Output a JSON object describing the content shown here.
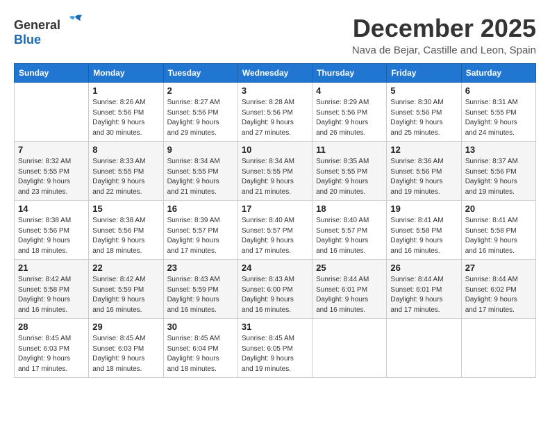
{
  "header": {
    "logo_general": "General",
    "logo_blue": "Blue",
    "month_title": "December 2025",
    "location": "Nava de Bejar, Castille and Leon, Spain"
  },
  "days_of_week": [
    "Sunday",
    "Monday",
    "Tuesday",
    "Wednesday",
    "Thursday",
    "Friday",
    "Saturday"
  ],
  "weeks": [
    [
      {
        "day": "",
        "info": ""
      },
      {
        "day": "1",
        "info": "Sunrise: 8:26 AM\nSunset: 5:56 PM\nDaylight: 9 hours\nand 30 minutes."
      },
      {
        "day": "2",
        "info": "Sunrise: 8:27 AM\nSunset: 5:56 PM\nDaylight: 9 hours\nand 29 minutes."
      },
      {
        "day": "3",
        "info": "Sunrise: 8:28 AM\nSunset: 5:56 PM\nDaylight: 9 hours\nand 27 minutes."
      },
      {
        "day": "4",
        "info": "Sunrise: 8:29 AM\nSunset: 5:56 PM\nDaylight: 9 hours\nand 26 minutes."
      },
      {
        "day": "5",
        "info": "Sunrise: 8:30 AM\nSunset: 5:56 PM\nDaylight: 9 hours\nand 25 minutes."
      },
      {
        "day": "6",
        "info": "Sunrise: 8:31 AM\nSunset: 5:55 PM\nDaylight: 9 hours\nand 24 minutes."
      }
    ],
    [
      {
        "day": "7",
        "info": "Sunrise: 8:32 AM\nSunset: 5:55 PM\nDaylight: 9 hours\nand 23 minutes."
      },
      {
        "day": "8",
        "info": "Sunrise: 8:33 AM\nSunset: 5:55 PM\nDaylight: 9 hours\nand 22 minutes."
      },
      {
        "day": "9",
        "info": "Sunrise: 8:34 AM\nSunset: 5:55 PM\nDaylight: 9 hours\nand 21 minutes."
      },
      {
        "day": "10",
        "info": "Sunrise: 8:34 AM\nSunset: 5:55 PM\nDaylight: 9 hours\nand 21 minutes."
      },
      {
        "day": "11",
        "info": "Sunrise: 8:35 AM\nSunset: 5:55 PM\nDaylight: 9 hours\nand 20 minutes."
      },
      {
        "day": "12",
        "info": "Sunrise: 8:36 AM\nSunset: 5:56 PM\nDaylight: 9 hours\nand 19 minutes."
      },
      {
        "day": "13",
        "info": "Sunrise: 8:37 AM\nSunset: 5:56 PM\nDaylight: 9 hours\nand 19 minutes."
      }
    ],
    [
      {
        "day": "14",
        "info": "Sunrise: 8:38 AM\nSunset: 5:56 PM\nDaylight: 9 hours\nand 18 minutes."
      },
      {
        "day": "15",
        "info": "Sunrise: 8:38 AM\nSunset: 5:56 PM\nDaylight: 9 hours\nand 18 minutes."
      },
      {
        "day": "16",
        "info": "Sunrise: 8:39 AM\nSunset: 5:57 PM\nDaylight: 9 hours\nand 17 minutes."
      },
      {
        "day": "17",
        "info": "Sunrise: 8:40 AM\nSunset: 5:57 PM\nDaylight: 9 hours\nand 17 minutes."
      },
      {
        "day": "18",
        "info": "Sunrise: 8:40 AM\nSunset: 5:57 PM\nDaylight: 9 hours\nand 16 minutes."
      },
      {
        "day": "19",
        "info": "Sunrise: 8:41 AM\nSunset: 5:58 PM\nDaylight: 9 hours\nand 16 minutes."
      },
      {
        "day": "20",
        "info": "Sunrise: 8:41 AM\nSunset: 5:58 PM\nDaylight: 9 hours\nand 16 minutes."
      }
    ],
    [
      {
        "day": "21",
        "info": "Sunrise: 8:42 AM\nSunset: 5:58 PM\nDaylight: 9 hours\nand 16 minutes."
      },
      {
        "day": "22",
        "info": "Sunrise: 8:42 AM\nSunset: 5:59 PM\nDaylight: 9 hours\nand 16 minutes."
      },
      {
        "day": "23",
        "info": "Sunrise: 8:43 AM\nSunset: 5:59 PM\nDaylight: 9 hours\nand 16 minutes."
      },
      {
        "day": "24",
        "info": "Sunrise: 8:43 AM\nSunset: 6:00 PM\nDaylight: 9 hours\nand 16 minutes."
      },
      {
        "day": "25",
        "info": "Sunrise: 8:44 AM\nSunset: 6:01 PM\nDaylight: 9 hours\nand 16 minutes."
      },
      {
        "day": "26",
        "info": "Sunrise: 8:44 AM\nSunset: 6:01 PM\nDaylight: 9 hours\nand 17 minutes."
      },
      {
        "day": "27",
        "info": "Sunrise: 8:44 AM\nSunset: 6:02 PM\nDaylight: 9 hours\nand 17 minutes."
      }
    ],
    [
      {
        "day": "28",
        "info": "Sunrise: 8:45 AM\nSunset: 6:03 PM\nDaylight: 9 hours\nand 17 minutes."
      },
      {
        "day": "29",
        "info": "Sunrise: 8:45 AM\nSunset: 6:03 PM\nDaylight: 9 hours\nand 18 minutes."
      },
      {
        "day": "30",
        "info": "Sunrise: 8:45 AM\nSunset: 6:04 PM\nDaylight: 9 hours\nand 18 minutes."
      },
      {
        "day": "31",
        "info": "Sunrise: 8:45 AM\nSunset: 6:05 PM\nDaylight: 9 hours\nand 19 minutes."
      },
      {
        "day": "",
        "info": ""
      },
      {
        "day": "",
        "info": ""
      },
      {
        "day": "",
        "info": ""
      }
    ]
  ]
}
